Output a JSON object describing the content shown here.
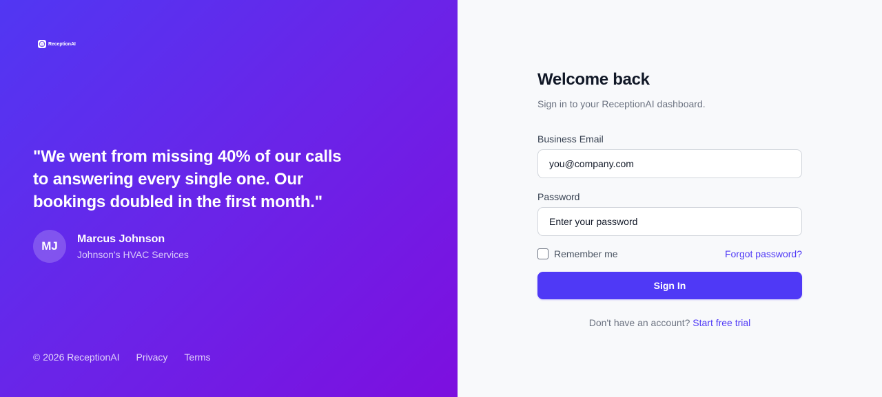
{
  "brand": {
    "name": "ReceptionAI",
    "logo_icon": "smile-face-icon",
    "gradient": [
      "#5137f3",
      "#7d0fdf"
    ]
  },
  "testimonial": {
    "quote": "\"We went from missing 40% of our calls to answering every single one. Our bookings doubled in the first month.\"",
    "author_initials": "MJ",
    "author_name": "Marcus Johnson",
    "author_company": "Johnson's HVAC Services"
  },
  "footer": {
    "copyright": "© 2026 ReceptionAI",
    "privacy": "Privacy",
    "terms": "Terms"
  },
  "form": {
    "title": "Welcome back",
    "subtitle": "Sign in to your ReceptionAI dashboard.",
    "email_label": "Business Email",
    "email_placeholder": "you@company.com",
    "password_label": "Password",
    "password_placeholder": "Enter your password",
    "remember_label": "Remember me",
    "remember_checked": false,
    "forgot_label": "Forgot password?",
    "submit_label": "Sign In",
    "signup_prompt": "Don't have an account?",
    "signup_link": "Start free trial",
    "accent_color": "#4f39f6"
  }
}
